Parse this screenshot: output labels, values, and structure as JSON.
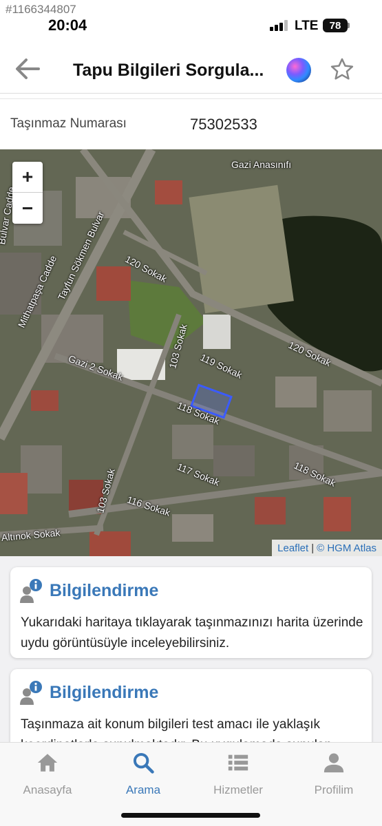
{
  "watermark": "#1166344807",
  "status_bar": {
    "time": "20:04",
    "network": "LTE",
    "battery": "78"
  },
  "header": {
    "title": "Tapu Bilgileri Sorgula...",
    "back_icon": "arrow-left-icon",
    "assistant_icon": "siri-icon",
    "favorite_icon": "star-outline-icon"
  },
  "parcel": {
    "label": "Taşınmaz Numarası",
    "value": "75302533"
  },
  "map": {
    "zoom_in": "+",
    "zoom_out": "−",
    "attribution_link": "Leaflet",
    "attribution_sep": "|",
    "attribution_source": "© HGM Atlas",
    "parcel_highlight_color": "#3b5bff",
    "street_labels": {
      "gazi_anasinifi": "Gazi Anasınıfı",
      "sokak_120_a": "120 Sokak",
      "sokak_120_b": "120 Sokak",
      "mithatpasa": "Mithatpaşa Cadde",
      "tayfun": "Tayfun Sökmen Bulvar",
      "bulvar": "Bulvar Cadde",
      "gazi2": "Gazi 2 Sokak",
      "sokak_119": "119 Sokak",
      "sokak_118_a": "118 Sokak",
      "sokak_118_b": "118 Sokak",
      "sokak_117": "117 Sokak",
      "sokak_116": "116 Sokak",
      "sokak_103_a": "103 Sokak",
      "sokak_103_b": "103 Sokak",
      "altinok": "Altınok Sokak"
    }
  },
  "cards": [
    {
      "icon": "user-info-icon",
      "title": "Bilgilendirme",
      "text": "Yukarıdaki haritaya tıklayarak taşınmazınızı harita üzerinde uydu görüntüsüyle inceleyebilirsiniz."
    },
    {
      "icon": "user-info-icon",
      "title": "Bilgilendirme",
      "text": "Taşınmaza ait konum bilgileri test amacı ile yaklaşık koordinatlarla sunulmaktadır. Bu uygulamada sunulan"
    }
  ],
  "tabs": [
    {
      "label": "Anasayfa",
      "icon": "home-icon",
      "active": false
    },
    {
      "label": "Arama",
      "icon": "search-icon",
      "active": true
    },
    {
      "label": "Hizmetler",
      "icon": "list-icon",
      "active": false
    },
    {
      "label": "Profilim",
      "icon": "user-icon",
      "active": false
    }
  ],
  "colors": {
    "accent": "#3a78b8",
    "inactive_tab": "#999999"
  }
}
